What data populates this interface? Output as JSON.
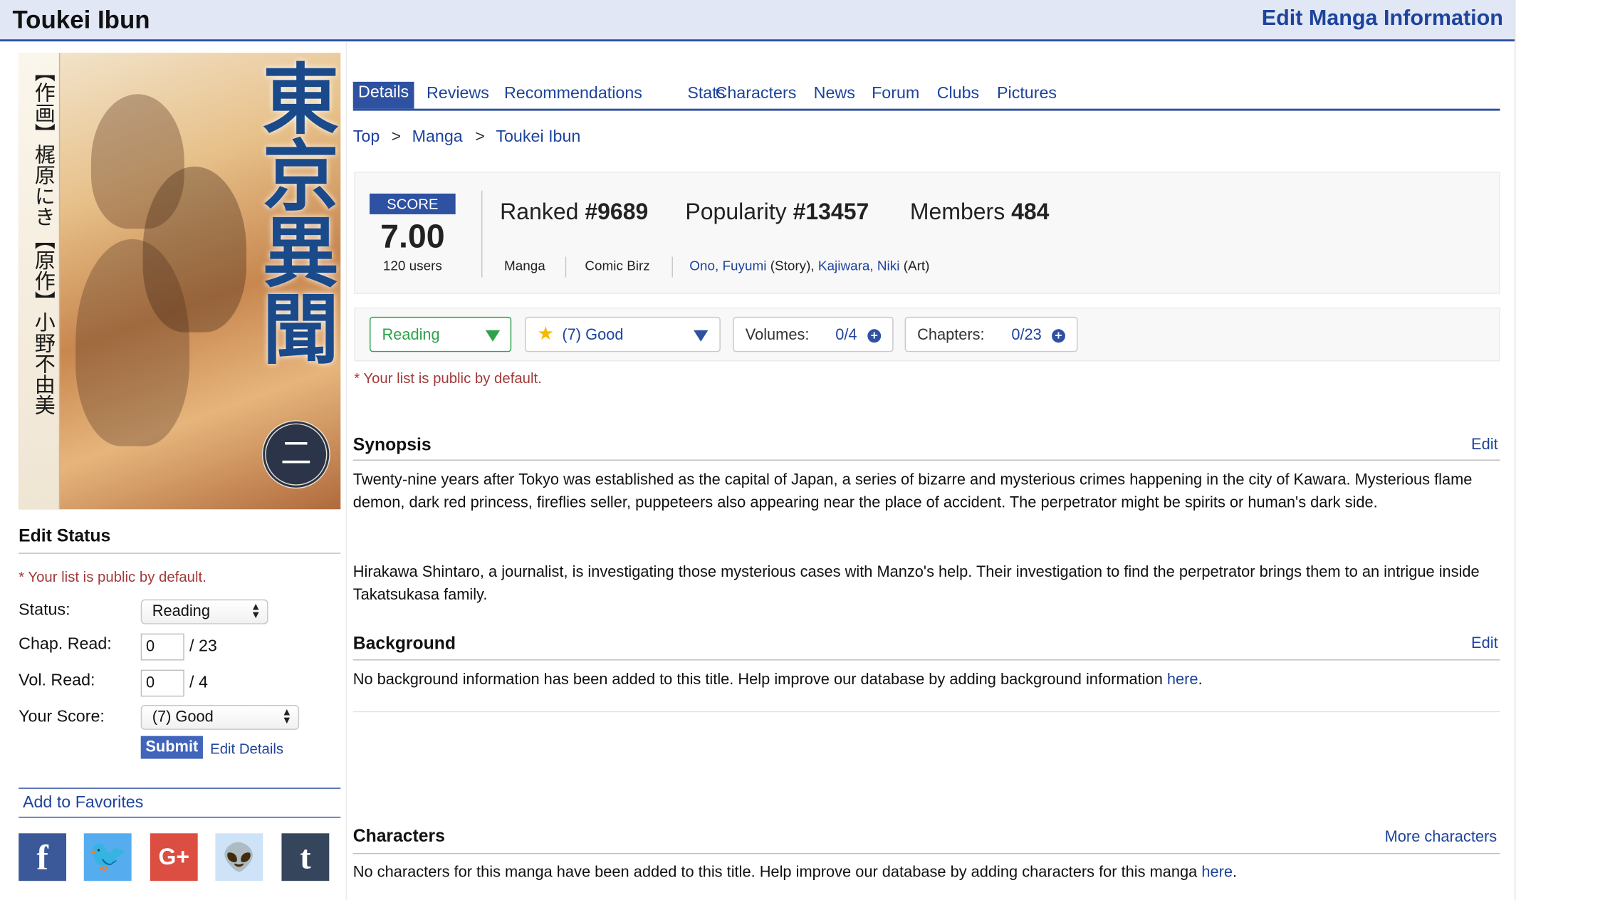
{
  "header": {
    "title": "Toukei Ibun",
    "edit_link": "Edit Manga Information"
  },
  "cover": {
    "side_top": "【作画】梶原にき",
    "side_bottom": "【原作】小野不由美",
    "big_title": "東京異聞",
    "seal": "二",
    "colors": {
      "title": "#1a4a8a"
    }
  },
  "edit_status": {
    "heading": "Edit Status",
    "note": "* Your list is public by default.",
    "status_label": "Status:",
    "status_value": "Reading",
    "chap_label": "Chap. Read:",
    "chap_value": "0",
    "chap_total": "/ 23",
    "vol_label": "Vol. Read:",
    "vol_value": "0",
    "vol_total": "/ 4",
    "score_label": "Your Score:",
    "score_value": "(7) Good",
    "submit": "Submit",
    "edit_details": "Edit Details"
  },
  "favorites": {
    "label": "Add to Favorites"
  },
  "social": {
    "facebook": "f",
    "twitter": "🐦",
    "google": "G+",
    "reddit": "👽",
    "tumblr": "t"
  },
  "tabs": [
    "Details",
    "Reviews",
    "Recommendations",
    "Stats",
    "Characters",
    "News",
    "Forum",
    "Clubs",
    "Pictures"
  ],
  "breadcrumb": [
    "Top",
    "Manga",
    "Toukei Ibun"
  ],
  "stats": {
    "score_label": "SCORE",
    "score": "7.00",
    "users": "120 users",
    "ranked_label": "Ranked",
    "ranked": "#9689",
    "popularity_label": "Popularity",
    "popularity": "#13457",
    "members_label": "Members",
    "members": "484",
    "type": "Manga",
    "serialization": "Comic Birz",
    "author1": "Ono, Fuyumi",
    "author1_role": "(Story),",
    "author2": "Kajiwara, Niki",
    "author2_role": "(Art)"
  },
  "list_controls": {
    "status": "Reading",
    "score": "(7) Good",
    "volumes_label": "Volumes:",
    "volumes": "0/4",
    "chapters_label": "Chapters:",
    "chapters": "0/23",
    "note": "* Your list is public by default.",
    "colors": {
      "status": "#2da24a",
      "accent": "#2e51a2"
    }
  },
  "synopsis": {
    "heading": "Synopsis",
    "edit": "Edit",
    "p1": "Twenty-nine years after Tokyo was established as the capital of Japan, a series of bizarre and mysterious crimes happening in the city of Kawara. Mysterious flame demon, dark red princess, fireflies seller, puppeteers also appearing near the place of accident. The perpetrator might be spirits or human's dark side.",
    "p2": "Hirakawa Shintaro, a journalist, is investigating those mysterious cases with Manzo's help. Their investigation to find the perpetrator brings them to an intrigue inside Takatsukasa family."
  },
  "background": {
    "heading": "Background",
    "edit": "Edit",
    "text": "No background information has been added to this title. Help improve our database by adding background information",
    "link": "here",
    "end": "."
  },
  "characters": {
    "heading": "Characters",
    "more": "More characters",
    "text": "No characters for this manga have been added to this title. Help improve our database by adding characters for this manga",
    "link": "here",
    "end": "."
  }
}
